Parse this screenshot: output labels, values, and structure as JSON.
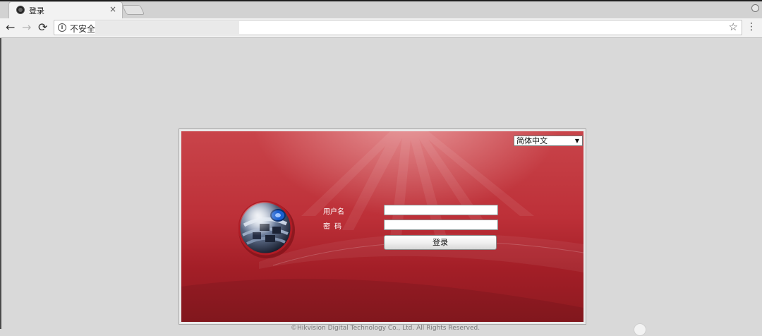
{
  "browser": {
    "tab": {
      "title": "登录",
      "favicon": "camera-favicon",
      "close_icon": "×"
    },
    "toolbar": {
      "back_icon": "←",
      "forward_icon": "→",
      "reload_icon": "⟳",
      "info_icon": "i",
      "security_label": "不安全",
      "url": "",
      "star_icon": "☆",
      "menu_icon": "⋮"
    }
  },
  "login": {
    "language_selected": "简体中文",
    "dropdown_icon": "▼",
    "username_label": "用户名",
    "password_label": "密码",
    "username_value": "",
    "password_value": "",
    "login_button": "登录",
    "copyright": "©Hikvision Digital Technology Co., Ltd. All Rights Reserved."
  },
  "colors": {
    "panel_red": "#bd3038",
    "panel_dark_red": "#8d1a20",
    "page_bg": "#d9d9d9",
    "chrome_bg": "#f2f2f2"
  }
}
